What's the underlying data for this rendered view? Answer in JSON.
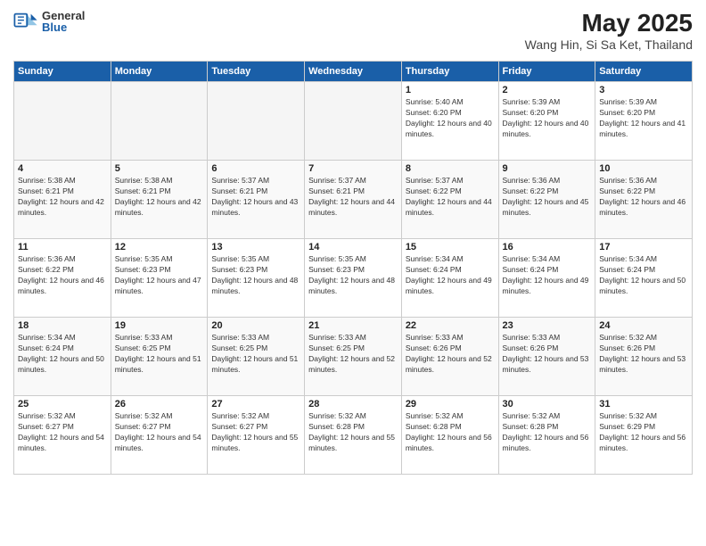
{
  "header": {
    "logo_general": "General",
    "logo_blue": "Blue",
    "month": "May 2025",
    "location": "Wang Hin, Si Sa Ket, Thailand"
  },
  "weekdays": [
    "Sunday",
    "Monday",
    "Tuesday",
    "Wednesday",
    "Thursday",
    "Friday",
    "Saturday"
  ],
  "weeks": [
    [
      {
        "day": "",
        "empty": true
      },
      {
        "day": "",
        "empty": true
      },
      {
        "day": "",
        "empty": true
      },
      {
        "day": "",
        "empty": true
      },
      {
        "day": "1",
        "sunrise": "5:40 AM",
        "sunset": "6:20 PM",
        "daylight": "12 hours and 40 minutes."
      },
      {
        "day": "2",
        "sunrise": "5:39 AM",
        "sunset": "6:20 PM",
        "daylight": "12 hours and 40 minutes."
      },
      {
        "day": "3",
        "sunrise": "5:39 AM",
        "sunset": "6:20 PM",
        "daylight": "12 hours and 41 minutes."
      }
    ],
    [
      {
        "day": "4",
        "sunrise": "5:38 AM",
        "sunset": "6:21 PM",
        "daylight": "12 hours and 42 minutes."
      },
      {
        "day": "5",
        "sunrise": "5:38 AM",
        "sunset": "6:21 PM",
        "daylight": "12 hours and 42 minutes."
      },
      {
        "day": "6",
        "sunrise": "5:37 AM",
        "sunset": "6:21 PM",
        "daylight": "12 hours and 43 minutes."
      },
      {
        "day": "7",
        "sunrise": "5:37 AM",
        "sunset": "6:21 PM",
        "daylight": "12 hours and 44 minutes."
      },
      {
        "day": "8",
        "sunrise": "5:37 AM",
        "sunset": "6:22 PM",
        "daylight": "12 hours and 44 minutes."
      },
      {
        "day": "9",
        "sunrise": "5:36 AM",
        "sunset": "6:22 PM",
        "daylight": "12 hours and 45 minutes."
      },
      {
        "day": "10",
        "sunrise": "5:36 AM",
        "sunset": "6:22 PM",
        "daylight": "12 hours and 46 minutes."
      }
    ],
    [
      {
        "day": "11",
        "sunrise": "5:36 AM",
        "sunset": "6:22 PM",
        "daylight": "12 hours and 46 minutes."
      },
      {
        "day": "12",
        "sunrise": "5:35 AM",
        "sunset": "6:23 PM",
        "daylight": "12 hours and 47 minutes."
      },
      {
        "day": "13",
        "sunrise": "5:35 AM",
        "sunset": "6:23 PM",
        "daylight": "12 hours and 48 minutes."
      },
      {
        "day": "14",
        "sunrise": "5:35 AM",
        "sunset": "6:23 PM",
        "daylight": "12 hours and 48 minutes."
      },
      {
        "day": "15",
        "sunrise": "5:34 AM",
        "sunset": "6:24 PM",
        "daylight": "12 hours and 49 minutes."
      },
      {
        "day": "16",
        "sunrise": "5:34 AM",
        "sunset": "6:24 PM",
        "daylight": "12 hours and 49 minutes."
      },
      {
        "day": "17",
        "sunrise": "5:34 AM",
        "sunset": "6:24 PM",
        "daylight": "12 hours and 50 minutes."
      }
    ],
    [
      {
        "day": "18",
        "sunrise": "5:34 AM",
        "sunset": "6:24 PM",
        "daylight": "12 hours and 50 minutes."
      },
      {
        "day": "19",
        "sunrise": "5:33 AM",
        "sunset": "6:25 PM",
        "daylight": "12 hours and 51 minutes."
      },
      {
        "day": "20",
        "sunrise": "5:33 AM",
        "sunset": "6:25 PM",
        "daylight": "12 hours and 51 minutes."
      },
      {
        "day": "21",
        "sunrise": "5:33 AM",
        "sunset": "6:25 PM",
        "daylight": "12 hours and 52 minutes."
      },
      {
        "day": "22",
        "sunrise": "5:33 AM",
        "sunset": "6:26 PM",
        "daylight": "12 hours and 52 minutes."
      },
      {
        "day": "23",
        "sunrise": "5:33 AM",
        "sunset": "6:26 PM",
        "daylight": "12 hours and 53 minutes."
      },
      {
        "day": "24",
        "sunrise": "5:32 AM",
        "sunset": "6:26 PM",
        "daylight": "12 hours and 53 minutes."
      }
    ],
    [
      {
        "day": "25",
        "sunrise": "5:32 AM",
        "sunset": "6:27 PM",
        "daylight": "12 hours and 54 minutes."
      },
      {
        "day": "26",
        "sunrise": "5:32 AM",
        "sunset": "6:27 PM",
        "daylight": "12 hours and 54 minutes."
      },
      {
        "day": "27",
        "sunrise": "5:32 AM",
        "sunset": "6:27 PM",
        "daylight": "12 hours and 55 minutes."
      },
      {
        "day": "28",
        "sunrise": "5:32 AM",
        "sunset": "6:28 PM",
        "daylight": "12 hours and 55 minutes."
      },
      {
        "day": "29",
        "sunrise": "5:32 AM",
        "sunset": "6:28 PM",
        "daylight": "12 hours and 56 minutes."
      },
      {
        "day": "30",
        "sunrise": "5:32 AM",
        "sunset": "6:28 PM",
        "daylight": "12 hours and 56 minutes."
      },
      {
        "day": "31",
        "sunrise": "5:32 AM",
        "sunset": "6:29 PM",
        "daylight": "12 hours and 56 minutes."
      }
    ]
  ],
  "labels": {
    "sunrise": "Sunrise:",
    "sunset": "Sunset:",
    "daylight": "Daylight:"
  }
}
